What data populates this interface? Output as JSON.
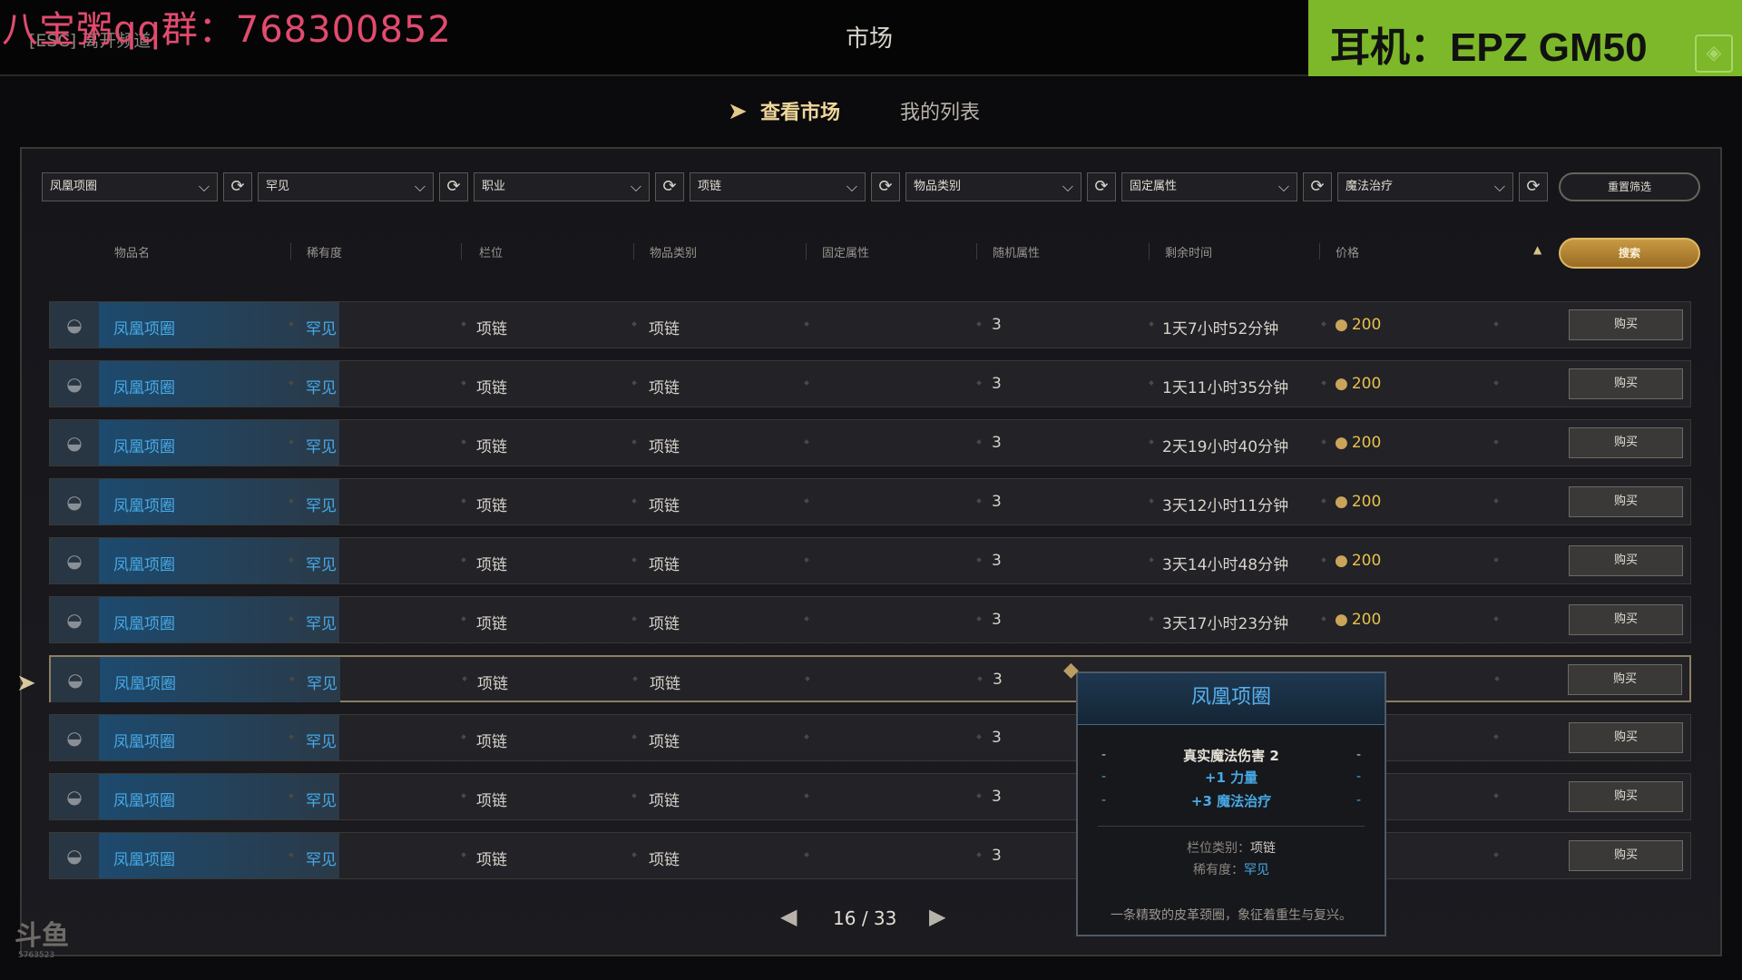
{
  "overlay_text": "八宝粥qq群：768300852",
  "header": {
    "esc_hint": "[ESC] 离开频道",
    "title": "市场"
  },
  "ad_banner": {
    "text": "耳机：EPZ GM50",
    "icon": "controller-icon"
  },
  "tabs": {
    "active": "查看市场",
    "other": "我的列表"
  },
  "filters": [
    {
      "value": "凤凰项圈"
    },
    {
      "value": "罕见"
    },
    {
      "value": "职业"
    },
    {
      "value": "项链"
    },
    {
      "value": "物品类别"
    },
    {
      "value": "固定属性"
    },
    {
      "value": "魔法治疗"
    }
  ],
  "reset_label": "重置筛选",
  "search_label": "搜索",
  "columns": [
    "物品名",
    "稀有度",
    "栏位",
    "物品类别",
    "固定属性",
    "随机属性",
    "剩余时间",
    "价格"
  ],
  "buy_label": "购买",
  "rows": [
    {
      "name": "凤凰项圈",
      "rarity": "罕见",
      "slot": "项链",
      "category": "项链",
      "random": "3",
      "time": "1天7小时52分钟",
      "price": "200"
    },
    {
      "name": "凤凰项圈",
      "rarity": "罕见",
      "slot": "项链",
      "category": "项链",
      "random": "3",
      "time": "1天11小时35分钟",
      "price": "200"
    },
    {
      "name": "凤凰项圈",
      "rarity": "罕见",
      "slot": "项链",
      "category": "项链",
      "random": "3",
      "time": "2天19小时40分钟",
      "price": "200"
    },
    {
      "name": "凤凰项圈",
      "rarity": "罕见",
      "slot": "项链",
      "category": "项链",
      "random": "3",
      "time": "3天12小时11分钟",
      "price": "200"
    },
    {
      "name": "凤凰项圈",
      "rarity": "罕见",
      "slot": "项链",
      "category": "项链",
      "random": "3",
      "time": "3天14小时48分钟",
      "price": "200"
    },
    {
      "name": "凤凰项圈",
      "rarity": "罕见",
      "slot": "项链",
      "category": "项链",
      "random": "3",
      "time": "3天17小时23分钟",
      "price": "200"
    },
    {
      "name": "凤凰项圈",
      "rarity": "罕见",
      "slot": "项链",
      "category": "项链",
      "random": "3",
      "time": "",
      "price": ""
    },
    {
      "name": "凤凰项圈",
      "rarity": "罕见",
      "slot": "项链",
      "category": "项链",
      "random": "3",
      "time": "",
      "price": ""
    },
    {
      "name": "凤凰项圈",
      "rarity": "罕见",
      "slot": "项链",
      "category": "项链",
      "random": "3",
      "time": "",
      "price": ""
    },
    {
      "name": "凤凰项圈",
      "rarity": "罕见",
      "slot": "项链",
      "category": "项链",
      "random": "3",
      "time": "",
      "price": ""
    }
  ],
  "pagination": {
    "current": "16",
    "separator": "/",
    "total": "33"
  },
  "tooltip": {
    "title": "凤凰项圈",
    "fixed_stat": "真实魔法伤害 2",
    "random_stats": [
      "+1 力量",
      "+3 魔法治疗"
    ],
    "slot_label": "栏位类别：",
    "slot_value": "项链",
    "rarity_label": "稀有度：",
    "rarity_value": "罕见",
    "description": "一条精致的皮革颈圈，象征着重生与复兴。"
  },
  "watermark": {
    "logo": "斗鱼",
    "sub": "5763523"
  },
  "colors": {
    "rarity_blue": "#47a9e6",
    "gold": "#e7c14a",
    "ad_green": "#7cb829",
    "accent": "#f0d79a",
    "overlay": "#e24b6e"
  }
}
